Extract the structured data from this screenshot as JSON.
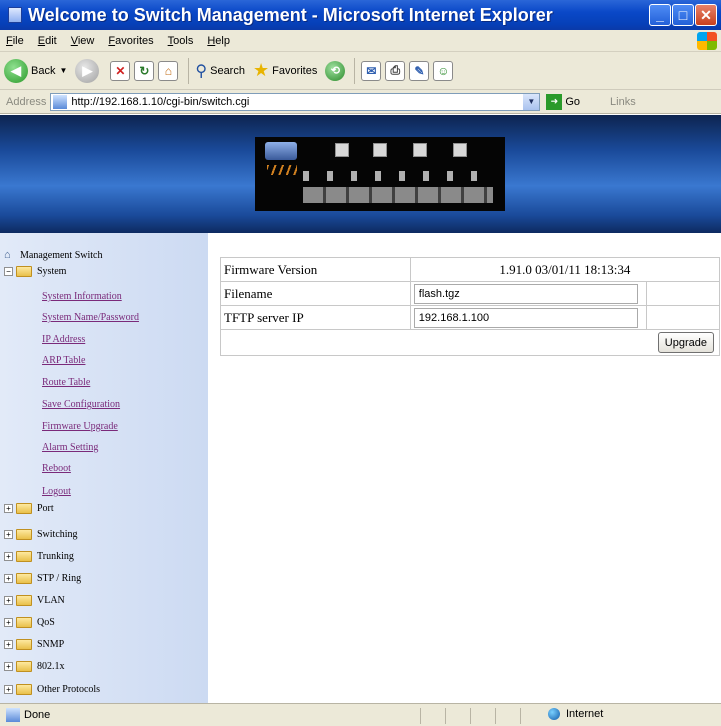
{
  "window": {
    "title": "Welcome to Switch Management - Microsoft Internet Explorer",
    "minimize": "_",
    "maximize": "□",
    "close": "✕"
  },
  "menu": [
    "File",
    "Edit",
    "View",
    "Favorites",
    "Tools",
    "Help"
  ],
  "toolbar": {
    "back_label": "Back",
    "search_label": "Search",
    "favorites_label": "Favorites"
  },
  "address_bar": {
    "label": "Address",
    "url": "http://192.168.1.10/cgi-bin/switch.cgi",
    "go_label": "Go",
    "links_label": "Links"
  },
  "sidebar": {
    "root_label": "Management Switch",
    "system": {
      "label": "System",
      "items": [
        "System Information",
        "System Name/Password",
        "IP Address",
        "ARP Table",
        "Route Table",
        "Save Configuration",
        "Firmware Upgrade",
        "Alarm Setting",
        "Reboot",
        "Logout"
      ]
    },
    "folders": [
      "Port",
      "Switching",
      "Trunking",
      "STP / Ring",
      "VLAN",
      "QoS",
      "SNMP",
      "802.1x",
      "Other Protocols"
    ]
  },
  "firmware_form": {
    "version_label": "Firmware Version",
    "version_value": "1.91.0 03/01/11 18:13:34",
    "filename_label": "Filename",
    "filename_value": "flash.tgz",
    "tftp_label": "TFTP server IP",
    "tftp_value": "192.168.1.100",
    "upgrade_label": "Upgrade"
  },
  "status_bar": {
    "status": "Done",
    "zone": "Internet"
  },
  "colors": {
    "titlebar": "#0a48c8",
    "sidebar_bg": "#d8e3f6",
    "link_visited": "#7a2a7a",
    "chrome": "#ece9d8"
  }
}
